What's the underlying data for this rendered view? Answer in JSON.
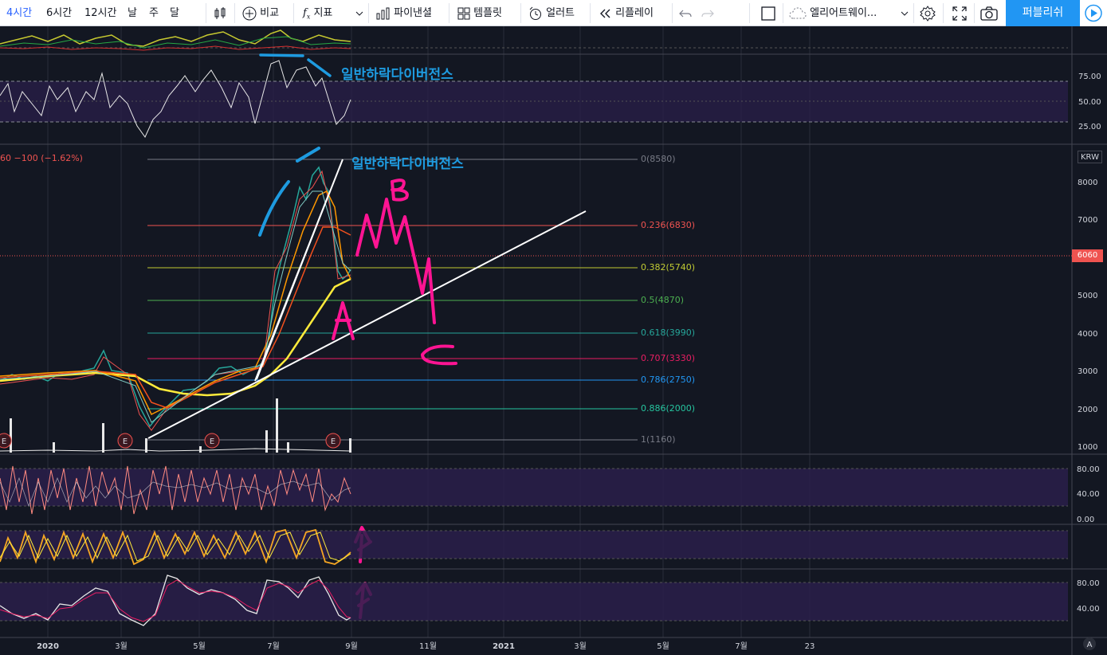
{
  "toolbar": {
    "intervals": [
      "4시간",
      "6시간",
      "12시간",
      "날",
      "주",
      "달"
    ],
    "active_interval": "4시간",
    "compare_label": "비교",
    "indicators_label": "지표",
    "pine_label": "파이낸셜",
    "template_label": "템플릿",
    "alert_label": "얼러트",
    "replay_label": "리플레이",
    "layout_label": "엘리어트웨이...",
    "publish_label": "퍼블리쉬"
  },
  "colors": {
    "accent": "#2962ff",
    "publish": "#2196f3",
    "bg": "#131722",
    "annotation": "#1e9be0",
    "wave": "#ff1493",
    "red": "#ef5350"
  },
  "main_chart": {
    "ohlc_change": "60  −100 (−1.62%)",
    "currency": "KRW",
    "current_price": "6060",
    "price_ticks": [
      "8000",
      "7000",
      "6000",
      "5000",
      "4000",
      "3000",
      "2000",
      "1000"
    ],
    "fib_levels": [
      {
        "label": "0(8580)",
        "value": 8580,
        "color": "#787b86"
      },
      {
        "label": "0.236(6830)",
        "value": 6830,
        "color": "#ef5350"
      },
      {
        "label": "0.382(5740)",
        "value": 5740,
        "color": "#c0ca33"
      },
      {
        "label": "0.5(4870)",
        "value": 4870,
        "color": "#4caf50"
      },
      {
        "label": "0.618(3990)",
        "value": 3990,
        "color": "#26a69a"
      },
      {
        "label": "0.707(3330)",
        "value": 3330,
        "color": "#e91e63"
      },
      {
        "label": "0.786(2750)",
        "value": 2750,
        "color": "#2196f3"
      },
      {
        "label": "0.886(2000)",
        "value": 2000,
        "color": "#26c6a0"
      },
      {
        "label": "1(1160)",
        "value": 1160,
        "color": "#787b86"
      }
    ],
    "earnings_marker": "E",
    "wave_labels": [
      "A",
      "B",
      "C"
    ],
    "annotation": "일반하락다이버전스"
  },
  "rsi_pane": {
    "ticks": [
      "75.00",
      "50.00",
      "25.00"
    ],
    "annotation": "일반하락다이버전스"
  },
  "osc_pane1": {
    "ticks": [
      "80.00",
      "40.00",
      "0.00"
    ]
  },
  "osc_pane3": {
    "ticks": [
      "80.00",
      "40.00"
    ]
  },
  "time_axis": [
    "2020",
    "3월",
    "5월",
    "7월",
    "9월",
    "11월",
    "2021",
    "3월",
    "5월",
    "7월",
    "23"
  ],
  "auto_label": "A"
}
